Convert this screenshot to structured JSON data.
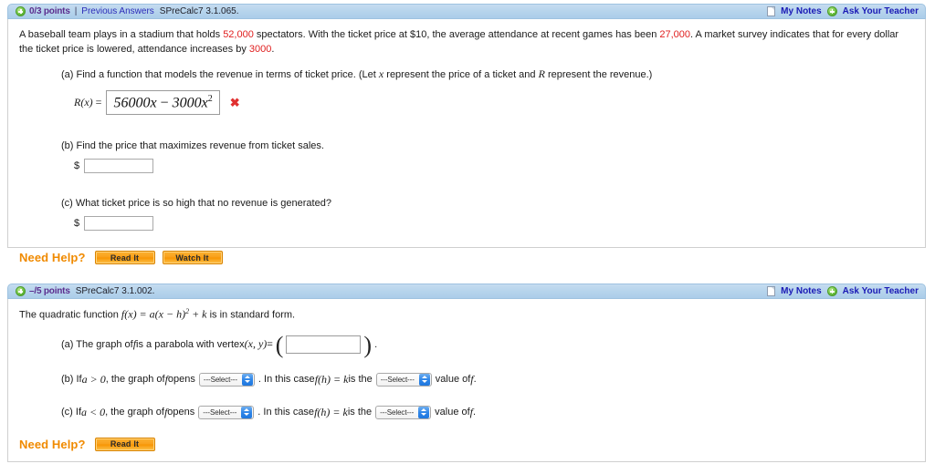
{
  "problems": [
    {
      "header": {
        "plus_icon": "plus-circle-icon",
        "points": "0/3 points",
        "separator": "|",
        "previous_answers": "Previous Answers",
        "code": "SPreCalc7 3.1.065.",
        "notes_icon": "note-page-icon",
        "my_notes": "My Notes",
        "ask_plus_icon": "plus-circle-icon",
        "ask_teacher": "Ask Your Teacher"
      },
      "stem": {
        "t1": "A baseball team plays in a stadium that holds ",
        "n1": "52,000",
        "t2": " spectators. With the ticket price at $10, the average attendance at recent games has been ",
        "n2": "27,000",
        "t3": ". A market survey indicates that for every dollar the ticket price is lowered, attendance increases by ",
        "n3": "3000",
        "t4": "."
      },
      "part_a": {
        "text_1": "(a) Find a function that models the revenue in terms of ticket price. (Let ",
        "var_x": "x",
        "text_2": " represent the price of a ticket and ",
        "var_r": "R",
        "text_3": " represent the revenue.)",
        "answer_label_fn": "R(x)",
        "answer_label_eq": " = ",
        "answer_value_a": "56000x",
        "answer_value_op": " − ",
        "answer_value_b": "3000x",
        "answer_value_exp": "2",
        "mark": "✖",
        "mark_name": "incorrect-mark"
      },
      "part_b": {
        "text": "(b) Find the price that maximizes revenue from ticket sales.",
        "dollar": "$",
        "input_value": "",
        "input_placeholder": ""
      },
      "part_c": {
        "text": "(c) What ticket price is so high that no revenue is generated?",
        "dollar": "$",
        "input_value": "",
        "input_placeholder": ""
      },
      "need_help": {
        "label": "Need Help?",
        "buttons": [
          "Read It",
          "Watch It"
        ]
      }
    },
    {
      "header": {
        "plus_icon": "plus-circle-icon",
        "points": "–/5 points",
        "code": "SPreCalc7 3.1.002.",
        "notes_icon": "note-page-icon",
        "my_notes": "My Notes",
        "ask_plus_icon": "plus-circle-icon",
        "ask_teacher": "Ask Your Teacher"
      },
      "stem": {
        "t1": "The quadratic function  ",
        "fn": "f(x) = a(x − h)",
        "exp": "2",
        "t2": " + k",
        "t3": "  is in standard form."
      },
      "part_a": {
        "text_1": "(a) The graph of ",
        "var_f": "f",
        "text_2": " is a parabola with vertex  ",
        "coords": "(x, y)",
        "eq": " = ",
        "open_paren": "(",
        "close_paren": ")",
        "period": ".",
        "input_value": "",
        "input_placeholder": ""
      },
      "part_b": {
        "text_1": "(b) If  ",
        "cond": "a > 0",
        "text_2": ",  the graph of ",
        "var_f": "f",
        "text_3": " opens",
        "select_1": "---Select---",
        "text_4": ". In this case  ",
        "expr": "f(h) = k",
        "text_5": "  is the",
        "select_2": "---Select---",
        "text_6": "value of ",
        "var_f2": "f",
        "text_7": "."
      },
      "part_c": {
        "text_1": "(c) If  ",
        "cond": "a < 0",
        "text_2": ",  the graph of ",
        "var_f": "f",
        "text_3": " opens",
        "select_1": "---Select---",
        "text_4": ". In this case  ",
        "expr": "f(h) = k",
        "text_5": "  is the",
        "select_2": "---Select---",
        "text_6": "value of ",
        "var_f2": "f",
        "text_7": "."
      },
      "need_help": {
        "label": "Need Help?",
        "buttons": [
          "Read It"
        ]
      }
    }
  ],
  "colors": {
    "header_blue": "#b6d4ec",
    "link_blue": "#1a1ab5",
    "points_purple": "#5b2d8e",
    "red_number": "#e02020",
    "orange": "#f08a00",
    "select_blue": "#2f86e8"
  }
}
